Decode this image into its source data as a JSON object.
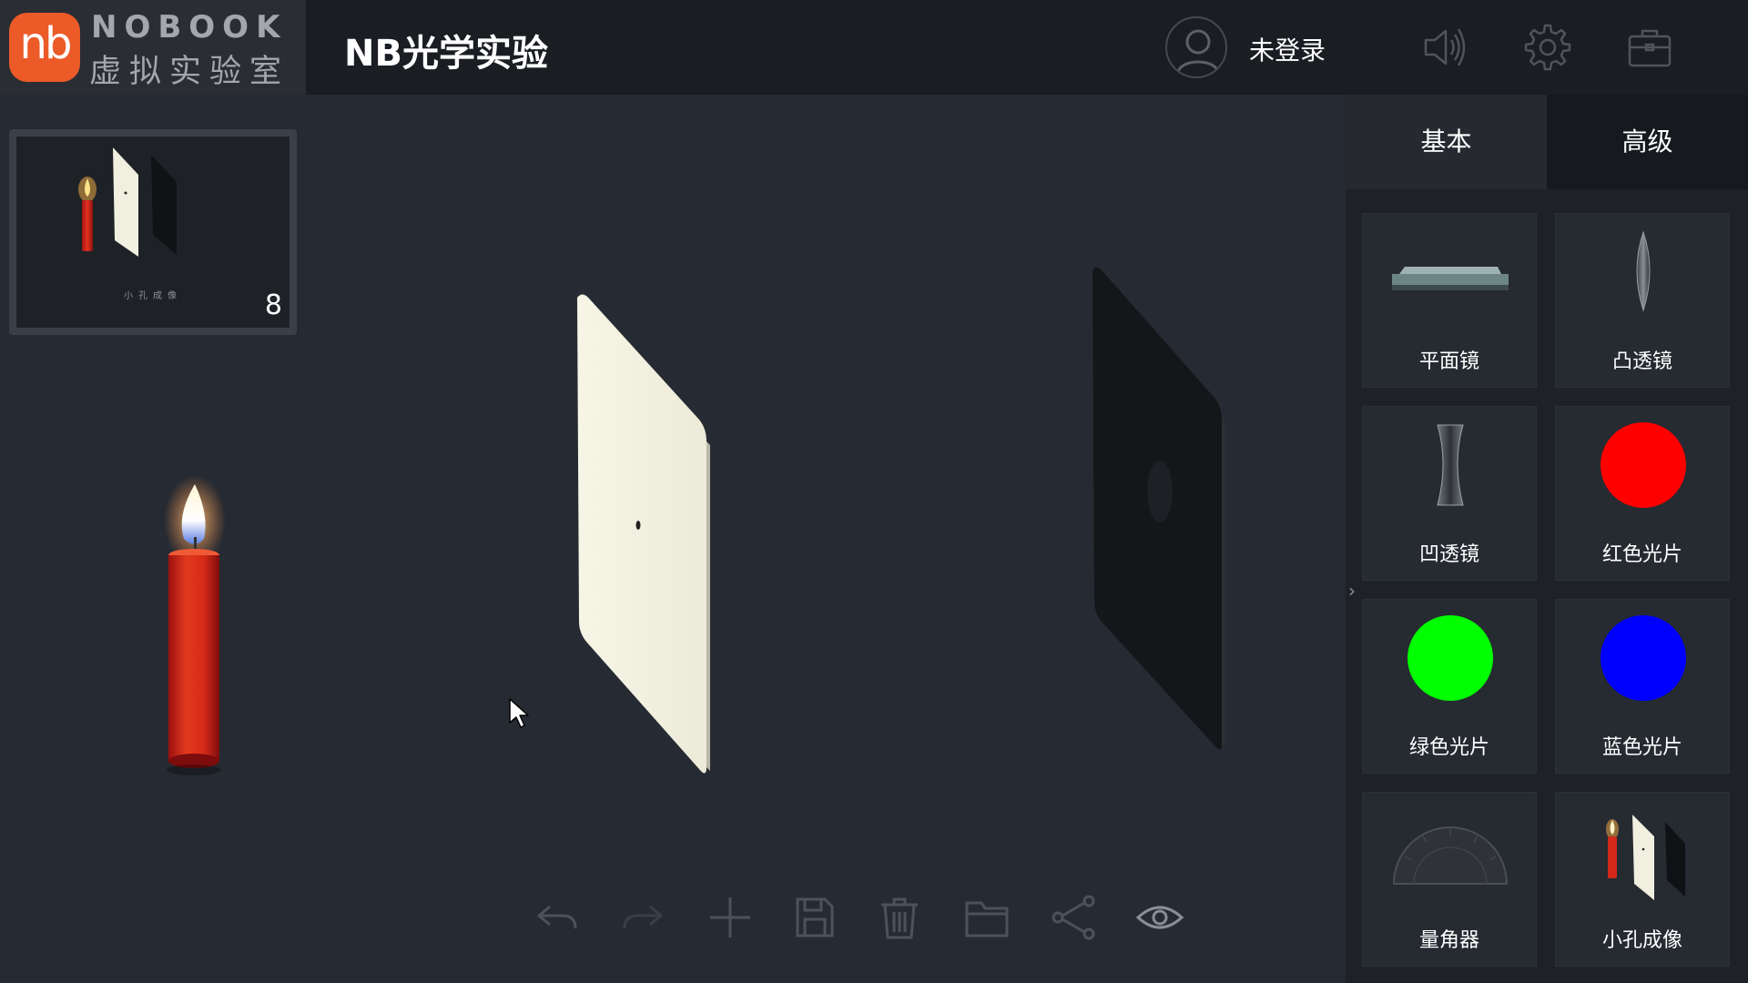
{
  "app": {
    "logo_mark": "nb",
    "brand_en": "NOBOOK",
    "brand_cn": "虚拟实验室",
    "title": "NB光学实验"
  },
  "header": {
    "login_status": "未登录",
    "icons": [
      "user-avatar-icon",
      "speaker-icon",
      "gear-icon",
      "briefcase-icon"
    ]
  },
  "scene_thumbnail": {
    "caption": "小孔成像",
    "count": "8"
  },
  "toolbar": {
    "icons": [
      "undo-icon",
      "redo-icon",
      "add-icon",
      "save-icon",
      "trash-icon",
      "folder-icon",
      "share-icon",
      "eye-icon"
    ]
  },
  "panel": {
    "tabs": [
      {
        "label": "基本",
        "active": true
      },
      {
        "label": "高级",
        "active": false
      }
    ],
    "items": [
      {
        "label": "平面镜",
        "icon": "plane-mirror-icon"
      },
      {
        "label": "凸透镜",
        "icon": "convex-lens-icon"
      },
      {
        "label": "凹透镜",
        "icon": "concave-lens-icon"
      },
      {
        "label": "红色光片",
        "icon": "red-filter-icon",
        "color": "#ff0000"
      },
      {
        "label": "绿色光片",
        "icon": "green-filter-icon",
        "color": "#00ff00"
      },
      {
        "label": "蓝色光片",
        "icon": "blue-filter-icon",
        "color": "#0000ff"
      },
      {
        "label": "量角器",
        "icon": "protractor-icon"
      },
      {
        "label": "小孔成像",
        "icon": "pinhole-imaging-icon"
      }
    ]
  },
  "colors": {
    "accent": "#ec5a28",
    "background": "#262b33",
    "header": "#1a1d22",
    "panel": "#1e2227"
  }
}
